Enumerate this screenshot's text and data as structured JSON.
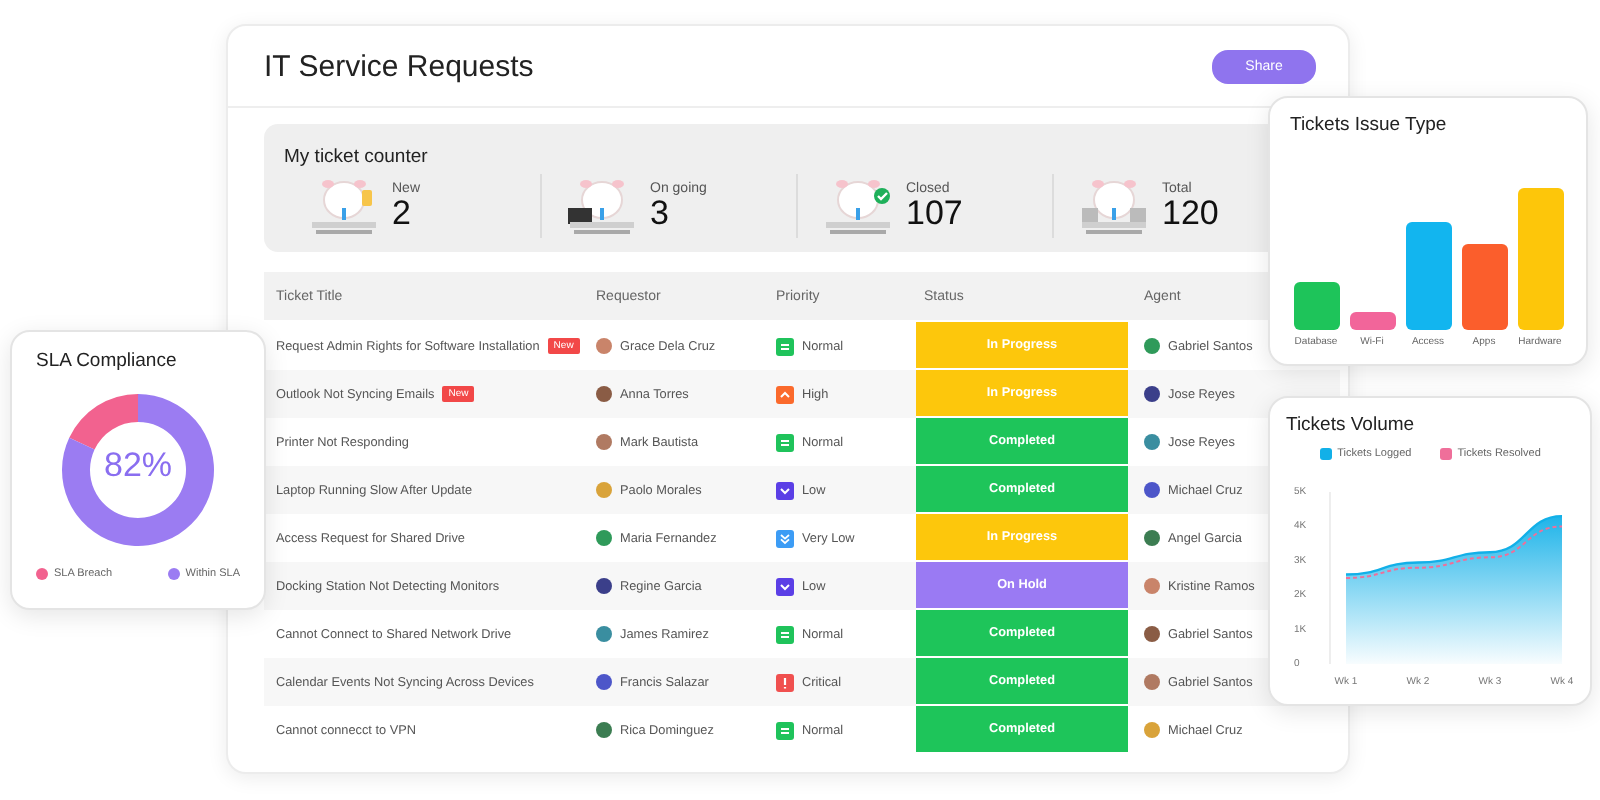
{
  "window": {
    "title": "IT Service Requests"
  },
  "share_button": "Share",
  "counter": {
    "title": "My ticket counter",
    "items": [
      {
        "label": "New",
        "value": "2",
        "kind": "new"
      },
      {
        "label": "On going",
        "value": "3",
        "kind": "laptop"
      },
      {
        "label": "Closed",
        "value": "107",
        "kind": "check"
      },
      {
        "label": "Total",
        "value": "120",
        "kind": "stack"
      }
    ]
  },
  "table": {
    "columns": [
      "Ticket Title",
      "Requestor",
      "Priority",
      "Status",
      "Agent"
    ],
    "rows": [
      {
        "title": "Request Admin Rights for Software Installation",
        "badge": "New",
        "requestor": "Grace Dela Cruz",
        "priority": {
          "label": "Normal",
          "kind": "normal"
        },
        "status": {
          "label": "In Progress",
          "kind": "progress"
        },
        "agent": "Gabriel Santos"
      },
      {
        "title": "Outlook Not Syncing Emails",
        "badge": "New",
        "requestor": "Anna Torres",
        "priority": {
          "label": "High",
          "kind": "high"
        },
        "status": {
          "label": "In Progress",
          "kind": "progress"
        },
        "agent": "Jose Reyes"
      },
      {
        "title": "Printer Not Responding",
        "requestor": "Mark Bautista",
        "priority": {
          "label": "Normal",
          "kind": "normal"
        },
        "status": {
          "label": "Completed",
          "kind": "completed"
        },
        "agent": "Jose Reyes"
      },
      {
        "title": "Laptop Running Slow After Update",
        "requestor": "Paolo Morales",
        "priority": {
          "label": "Low",
          "kind": "low"
        },
        "status": {
          "label": "Completed",
          "kind": "completed"
        },
        "agent": "Michael Cruz"
      },
      {
        "title": "Access Request for Shared Drive",
        "requestor": "Maria Fernandez",
        "priority": {
          "label": "Very Low",
          "kind": "verylow"
        },
        "status": {
          "label": "In Progress",
          "kind": "progress"
        },
        "agent": "Angel Garcia"
      },
      {
        "title": "Docking Station Not Detecting Monitors",
        "requestor": "Regine Garcia",
        "priority": {
          "label": "Low",
          "kind": "low"
        },
        "status": {
          "label": "On Hold",
          "kind": "hold"
        },
        "agent": "Kristine Ramos"
      },
      {
        "title": "Cannot Connect to Shared Network Drive",
        "requestor": "James Ramirez",
        "priority": {
          "label": "Normal",
          "kind": "normal"
        },
        "status": {
          "label": "Completed",
          "kind": "completed"
        },
        "agent": "Gabriel Santos"
      },
      {
        "title": "Calendar Events Not Syncing Across Devices",
        "requestor": "Francis Salazar",
        "priority": {
          "label": "Critical",
          "kind": "critical"
        },
        "status": {
          "label": "Completed",
          "kind": "completed"
        },
        "agent": "Gabriel Santos"
      },
      {
        "title": "Cannot connecct to VPN",
        "requestor": "Rica Dominguez",
        "priority": {
          "label": "Normal",
          "kind": "normal"
        },
        "status": {
          "label": "Completed",
          "kind": "completed"
        },
        "agent": "Michael Cruz"
      }
    ]
  },
  "sla": {
    "title": "SLA Compliance",
    "center": "82%",
    "chart_data": {
      "type": "donut",
      "categories": [
        "SLA Breach",
        "Within SLA"
      ],
      "values": [
        18,
        82
      ],
      "colors": [
        "#f2628f",
        "#9b7cf2"
      ]
    }
  },
  "issue_type": {
    "title": "Tickets Issue Type",
    "bars": [
      {
        "label": "Database",
        "color": "#1ec45a"
      },
      {
        "label": "Wi-Fi",
        "color": "#f2659a"
      },
      {
        "label": "Access",
        "color": "#12b5ef"
      },
      {
        "label": "Apps",
        "color": "#fb5e2c"
      },
      {
        "label": "Hardware",
        "color": "#fdc60a"
      }
    ]
  },
  "volume": {
    "title": "Tickets Volume",
    "chart_data": {
      "type": "area",
      "x": [
        "Wk 1",
        "Wk 2",
        "Wk 3",
        "Wk 4"
      ],
      "ylim": [
        0,
        5000
      ],
      "yticks": [
        {
          "value": 0,
          "label": "0"
        },
        {
          "value": 1000,
          "label": "1K"
        },
        {
          "value": 2000,
          "label": "2K"
        },
        {
          "value": 3000,
          "label": "3K"
        },
        {
          "value": 4000,
          "label": "4K"
        },
        {
          "value": 5000,
          "label": "5K"
        }
      ],
      "series": [
        {
          "name": "Tickets Logged",
          "color": "#12b0e8",
          "values": [
            2600,
            2950,
            3250,
            4300
          ]
        },
        {
          "name": "Tickets Resolved",
          "type": "line",
          "line_style": "dashed",
          "color": "#ef6f9a",
          "values": [
            2500,
            2800,
            3100,
            4000
          ]
        }
      ]
    }
  }
}
